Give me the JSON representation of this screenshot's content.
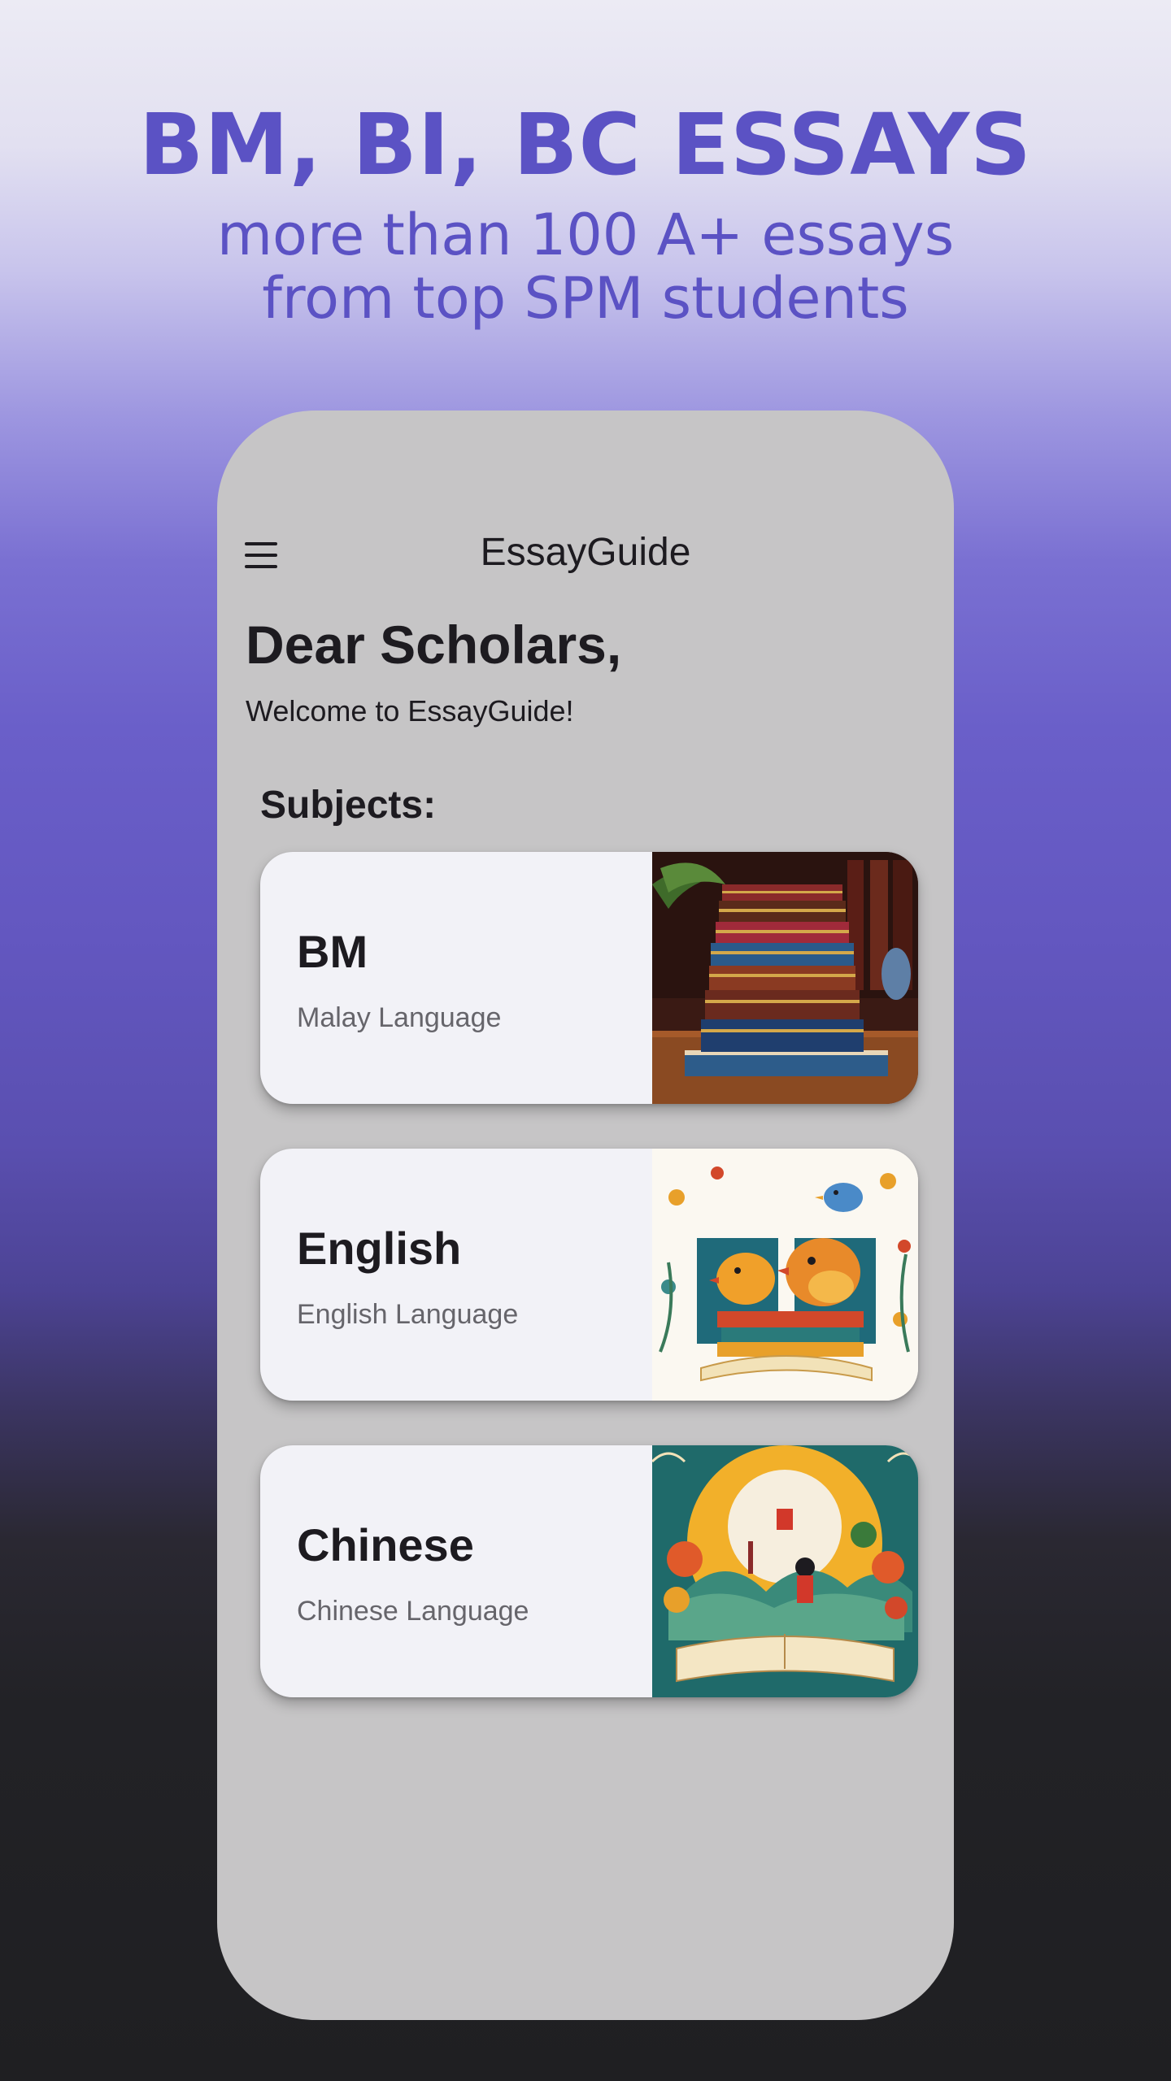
{
  "promo": {
    "title": "BM, BI, BC ESSAYS",
    "subtitle_line1": "more than 100 A+ essays",
    "subtitle_line2": "from top SPM students"
  },
  "app": {
    "title": "EssayGuide",
    "menu_icon": "hamburger-menu-icon",
    "greeting": "Dear Scholars,",
    "welcome": "Welcome to EssayGuide!",
    "subjects_label": "Subjects:"
  },
  "subjects": [
    {
      "title": "BM",
      "subtitle": "Malay Language",
      "image": "stacked-antique-books-illustration"
    },
    {
      "title": "English",
      "subtitle": "English Language",
      "image": "birds-on-books-floral-illustration"
    },
    {
      "title": "Chinese",
      "subtitle": "Chinese Language",
      "image": "open-book-chinese-landscape-illustration"
    }
  ],
  "colors": {
    "promo_text": "#5b52c4",
    "phone_background": "#c6c5c6",
    "card_background": "#f2f2f7",
    "primary_text": "#1d1b20",
    "secondary_text": "#66656b"
  }
}
